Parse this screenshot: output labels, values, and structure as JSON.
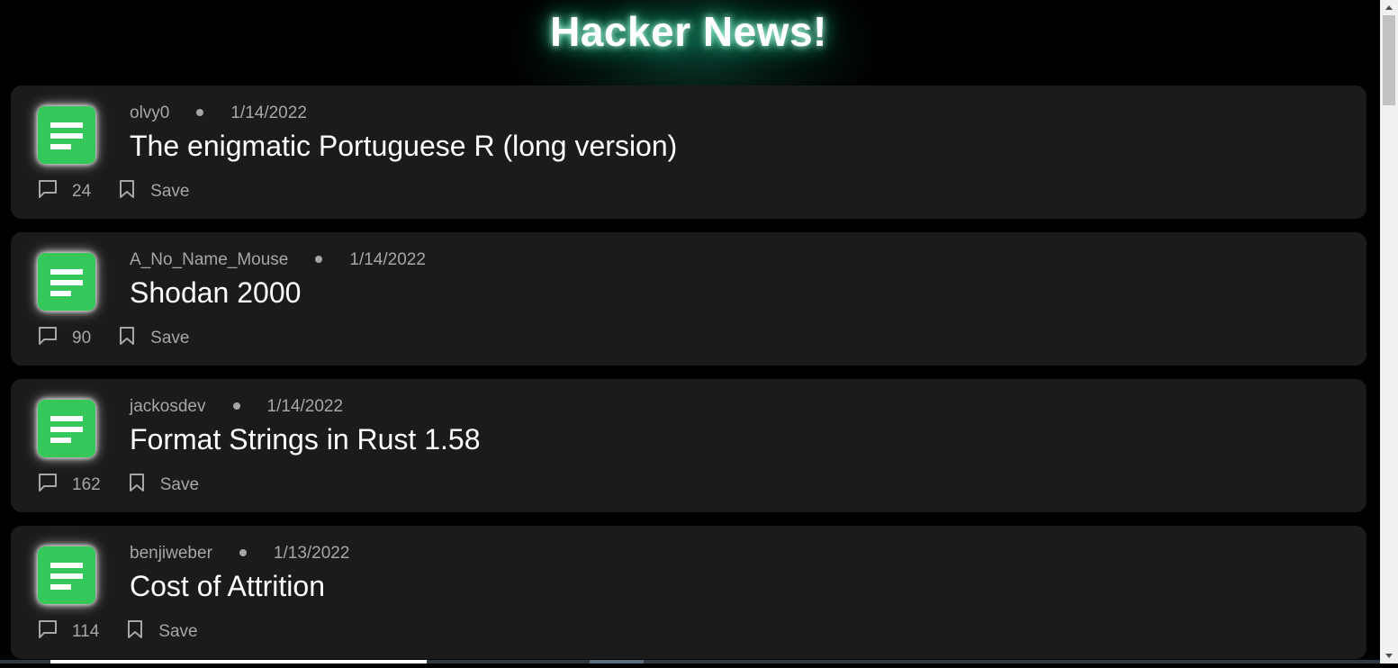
{
  "app": {
    "title": "Hacker News!"
  },
  "colors": {
    "background": "#000000",
    "card": "#1b1b1b",
    "accent_green": "#34c85a",
    "title_glow": "#26c48c",
    "muted_text": "#a6a6a6"
  },
  "stories": [
    {
      "author": "olvy0",
      "date": "1/14/2022",
      "title": "The enigmatic Portuguese R (long version)",
      "comments": "24",
      "save_label": "Save",
      "icon": "article-icon"
    },
    {
      "author": "A_No_Name_Mouse",
      "date": "1/14/2022",
      "title": "Shodan 2000",
      "comments": "90",
      "save_label": "Save",
      "icon": "article-icon"
    },
    {
      "author": "jackosdev",
      "date": "1/14/2022",
      "title": "Format Strings in Rust 1.58",
      "comments": "162",
      "save_label": "Save",
      "icon": "article-icon"
    },
    {
      "author": "benjiweber",
      "date": "1/13/2022",
      "title": "Cost of Attrition",
      "comments": "114",
      "save_label": "Save",
      "icon": "article-icon"
    }
  ]
}
